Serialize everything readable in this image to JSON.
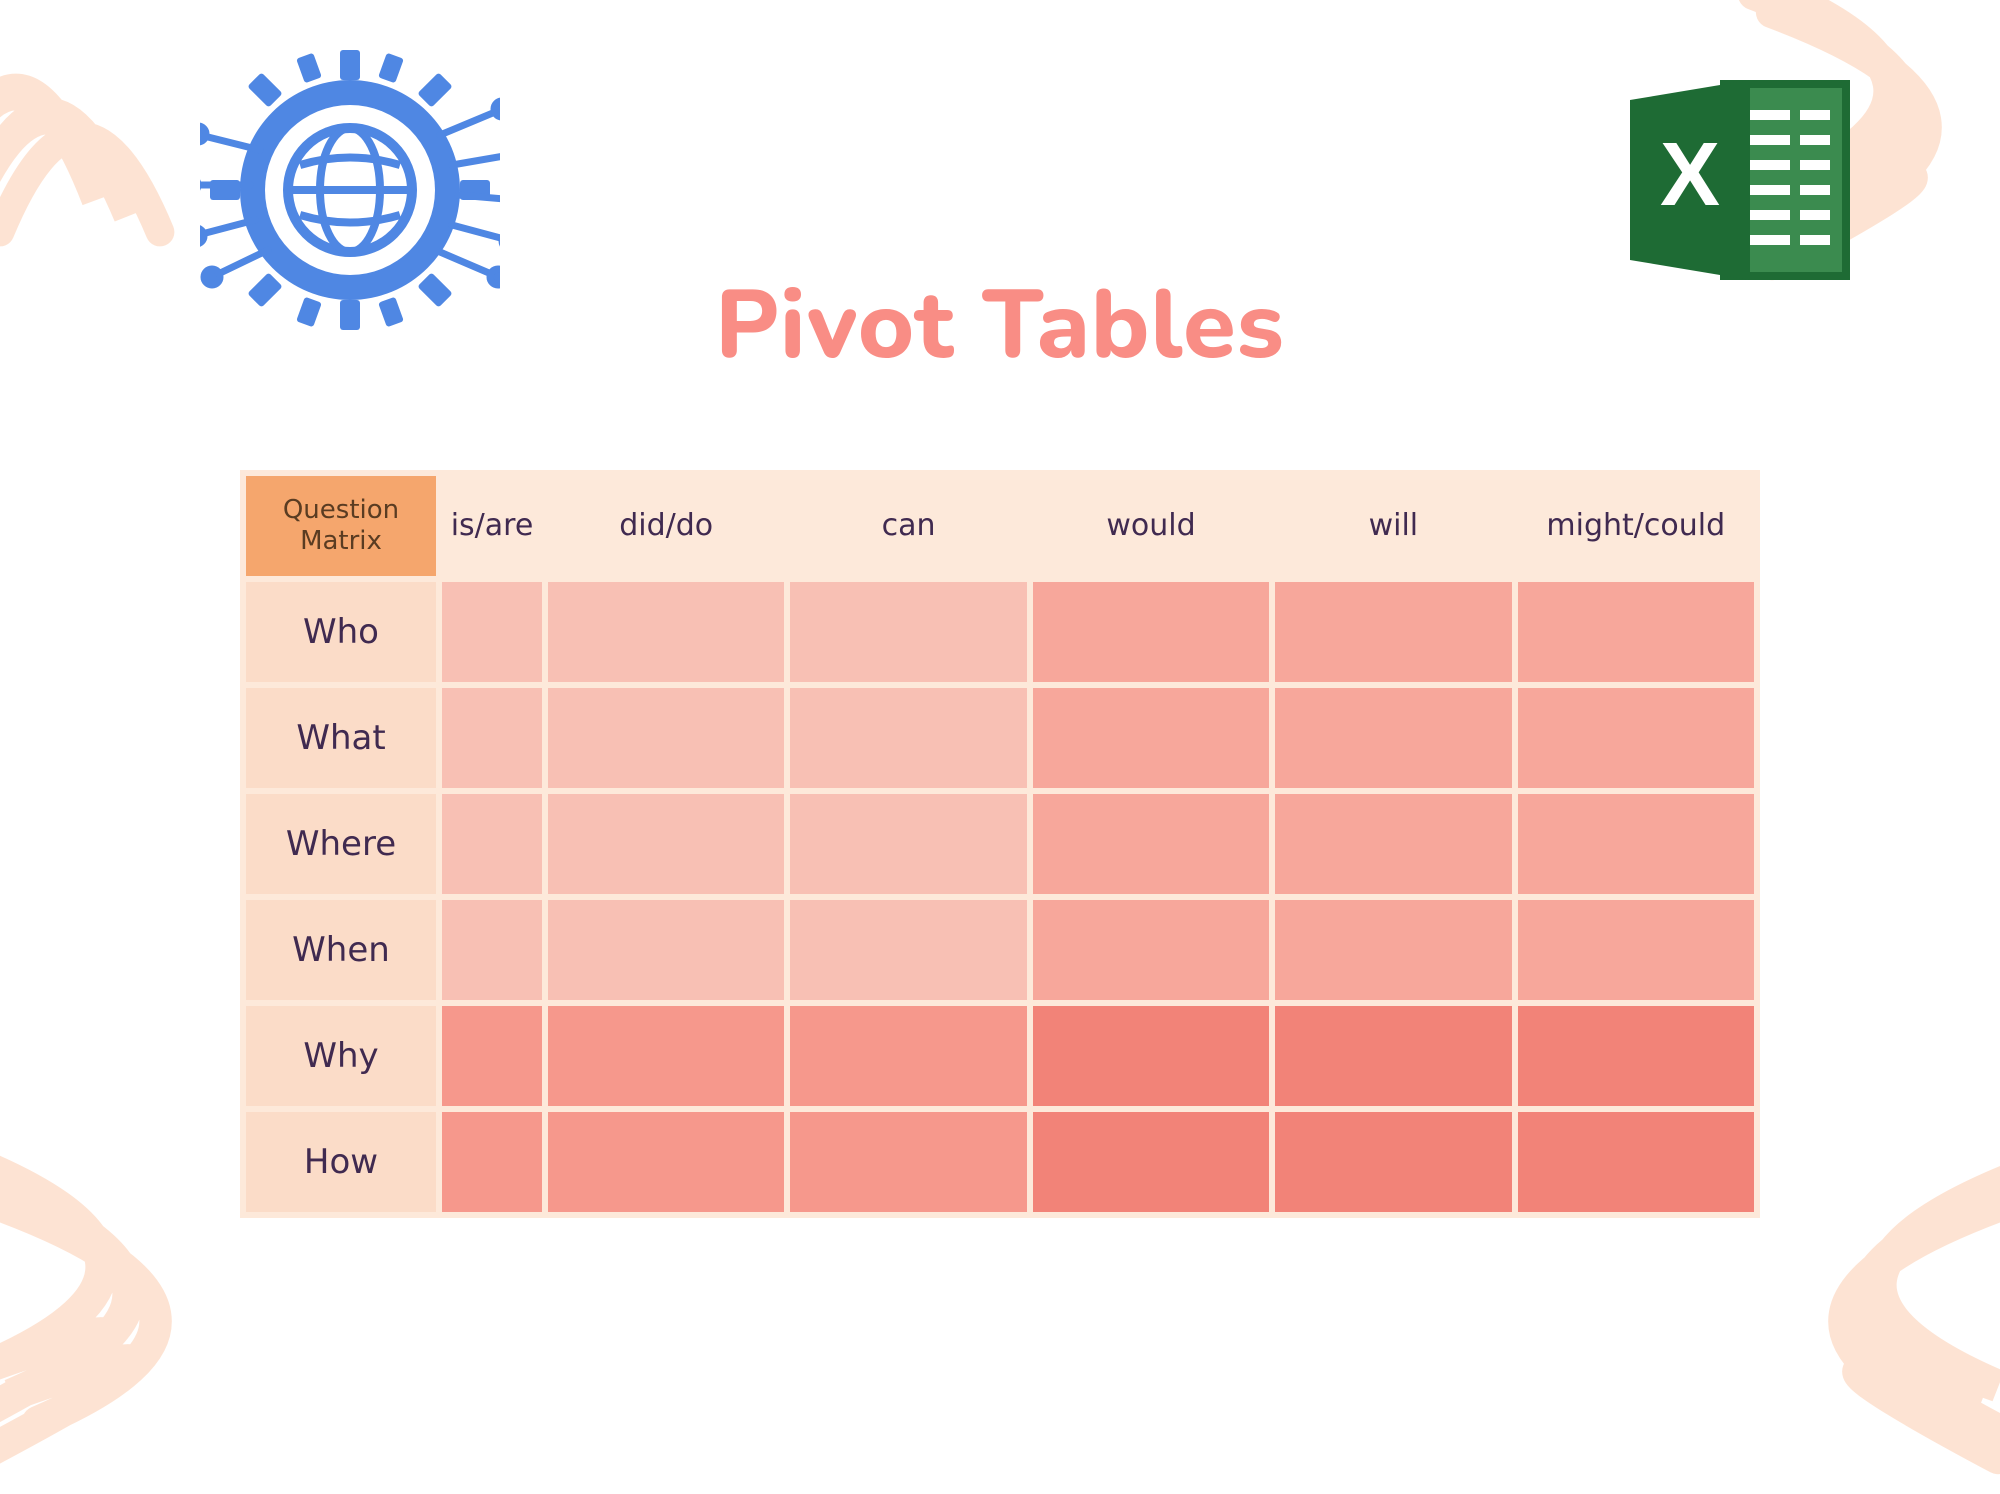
{
  "title": "Pivot Tables",
  "icons": {
    "globe_gear": "globe-gear-icon",
    "excel": "excel-icon"
  },
  "colors": {
    "title": "#f98d85",
    "corner_bg": "#f5a66d",
    "header_bg": "#fde9da",
    "rowhead_bg": "#fbdcc8",
    "cell_light": "#f8c0b4",
    "cell_mid": "#f7a79b",
    "cell_mdeep": "#f6988c",
    "cell_deep": "#f28378",
    "text": "#402a50"
  },
  "chart_data": {
    "type": "table",
    "title": "Pivot Tables",
    "corner_label": "Question Matrix",
    "columns": [
      "is/are",
      "did/do",
      "can",
      "would",
      "will",
      "might/could"
    ],
    "rows": [
      "Who",
      "What",
      "Where",
      "When",
      "Why",
      "How"
    ],
    "cell_shading": {
      "note": "Heatmap shade level 1-4 (light→deep). Rows 1-4 use [1,1,1,2,2,2]; rows 5-6 use [3,3,3,4,4,4].",
      "levels_by_row": [
        [
          1,
          1,
          1,
          2,
          2,
          2
        ],
        [
          1,
          1,
          1,
          2,
          2,
          2
        ],
        [
          1,
          1,
          1,
          2,
          2,
          2
        ],
        [
          1,
          1,
          1,
          2,
          2,
          2
        ],
        [
          3,
          3,
          3,
          4,
          4,
          4
        ],
        [
          3,
          3,
          3,
          4,
          4,
          4
        ]
      ]
    }
  }
}
